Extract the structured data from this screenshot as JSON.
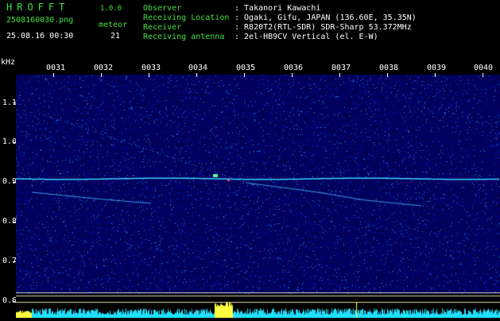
{
  "header": {
    "app_title": "HROFFT",
    "version": "1.0.0",
    "filename": "2508160030.png",
    "datetime": "25.08.16 00:30",
    "meteor_label": "meteor",
    "meteor_count": "21",
    "info": [
      {
        "key": "Observer",
        "value": ": Takanori Kawachi"
      },
      {
        "key": "Receiving Location",
        "value": ": Ogaki, Gifu, JAPAN (136.60E, 35.35N)"
      },
      {
        "key": "Receiver",
        "value": ": R820T2(RTL-SDR) SDR-Sharp 53.372MHz"
      },
      {
        "key": "Receiving antenna",
        "value": ": 2el-HB9CV Vertical (el. E-W)"
      }
    ]
  },
  "axis": {
    "y_unit": "kHz",
    "y_ticks": [
      "1.1",
      "1.0",
      "0.9",
      "0.8",
      "0.7",
      "0.6"
    ],
    "x_ticks": [
      "0031",
      "0032",
      "0033",
      "0034",
      "0035",
      "0036",
      "0037",
      "0038",
      "0039",
      "0040"
    ]
  },
  "colors": {
    "background": "#000000",
    "spectrum": "#0a0a5a",
    "text_green": "#3fe23f",
    "trace": "#40d0ff",
    "meter": "#20e0ff",
    "meter_peak": "#ffff40"
  }
}
